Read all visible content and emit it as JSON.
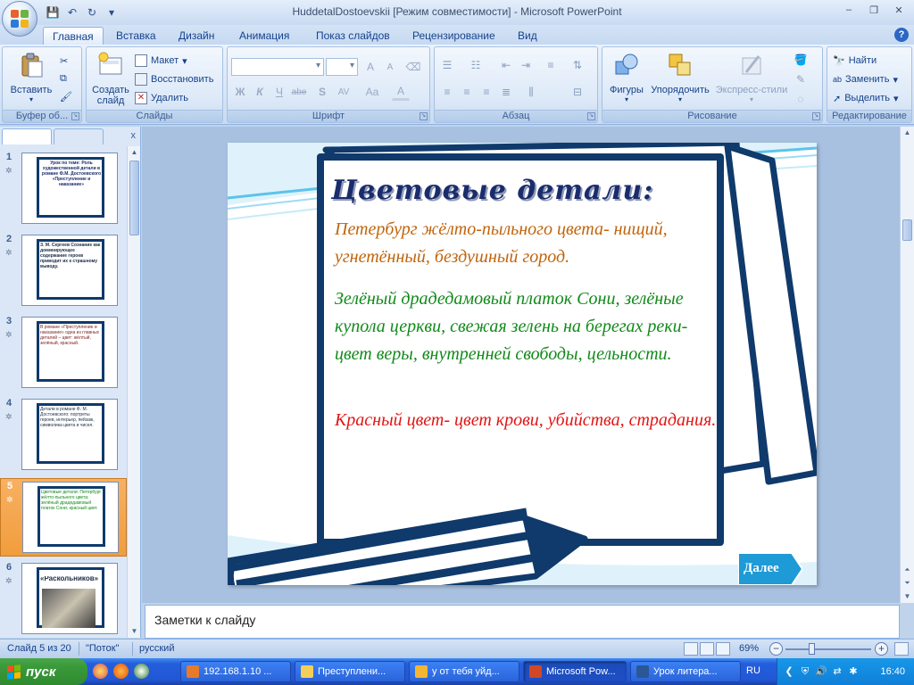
{
  "window": {
    "title": "HuddetalDostoevskii [Режим совместимости] - Microsoft PowerPoint",
    "controls": {
      "minimize": "–",
      "maximize": "❐",
      "close": "✕"
    }
  },
  "quick_access": {
    "save": "💾",
    "undo": "↶",
    "redo": "↻",
    "customize": "▾"
  },
  "ribbon_tabs": [
    "Главная",
    "Вставка",
    "Дизайн",
    "Анимация",
    "Показ слайдов",
    "Рецензирование",
    "Вид"
  ],
  "help": "?",
  "ribbon": {
    "clipboard": {
      "paste": "Вставить",
      "label": "Буфер об..."
    },
    "slides": {
      "create_line1": "Создать",
      "create_line2": "слайд",
      "layout": "Макет",
      "reset": "Восстановить",
      "delete": "Удалить",
      "label": "Слайды"
    },
    "font": {
      "label": "Шрифт",
      "bold": "Ж",
      "italic": "К",
      "underline": "Ч",
      "strike": "abe",
      "shadow": "S",
      "spacing": "AV",
      "case": "Aa",
      "color": "A",
      "grow": "A",
      "shrink": "A"
    },
    "paragraph": {
      "label": "Абзац"
    },
    "drawing": {
      "shapes": "Фигуры",
      "arrange": "Упорядочить",
      "quick_styles": "Экспресс-стили",
      "label": "Рисование"
    },
    "editing": {
      "find": "Найти",
      "replace": "Заменить",
      "select": "Выделить",
      "label": "Редактирование"
    }
  },
  "panel": {
    "close": "x"
  },
  "thumbnails": [
    {
      "num": "1",
      "text": "Урок по теме: Роль художественной детали в романе Ф.М. Достоевского «Преступление и наказание»"
    },
    {
      "num": "2",
      "text": "З. М. Сергеев Сознание как доминирующее содержание героев приводит их к страшному выводу."
    },
    {
      "num": "3",
      "text": "В романе «Преступление и наказание» одна из главных деталей – цвет: жёлтый, зелёный, красный."
    },
    {
      "num": "4",
      "text": "Детали в романе Ф. М. Достоевского: портреты героев, интерьер, пейзаж, символика цвета и чисел."
    },
    {
      "num": "5",
      "text": "Цветовые детали: Петербург жёлто-пыльного цвета; зелёный драдедамовый платок Сони; красный цвет."
    },
    {
      "num": "6",
      "text": "«Раскольников»"
    }
  ],
  "slide": {
    "title": "Цветовые детали:",
    "p1": "Петербург жёлто-пыльного цвета- нищий, угнетённый, бездушный город.",
    "p2": "Зелёный драдедамовый платок Сони, зелёные купола церкви, свежая зелень на берегах реки- цвет веры, внутренней свободы, цельности.",
    "p3": "Красный цвет- цвет крови, убийства, страдания.",
    "next": "Далее",
    "colors": {
      "frame": "#0f3a6b",
      "p1": "#c0650d",
      "p2": "#118a1a",
      "p3": "#e01515",
      "accent": "#1e9ad6"
    }
  },
  "notes": {
    "placeholder": "Заметки к слайду"
  },
  "status": {
    "slide": "Слайд 5 из 20",
    "theme": "\"Поток\"",
    "language": "русский",
    "zoom": "69%"
  },
  "taskbar": {
    "start": "пуск",
    "tasks": [
      "192.168.1.10 ...",
      "Преступлени...",
      "у от тебя уйд...",
      "Microsoft Pow...",
      "Урок литера..."
    ],
    "lang": "RU",
    "clock": "16:40"
  }
}
